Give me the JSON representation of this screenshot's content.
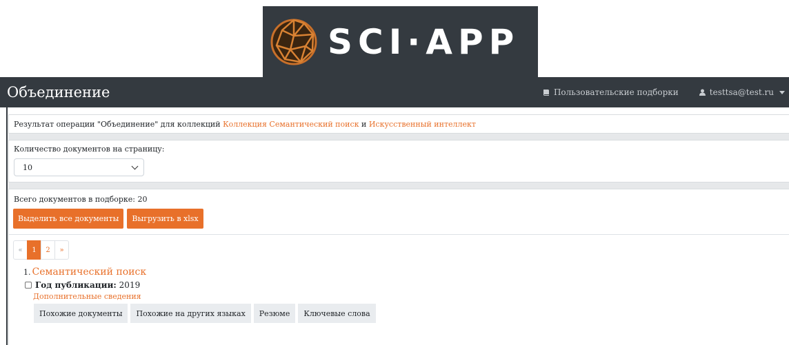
{
  "logo": {
    "text": "SCI·APP",
    "icon": "geodesic-sphere-icon",
    "background": "#343a40"
  },
  "navbar": {
    "brand": "Объединение",
    "collections_icon": "book-icon",
    "collections_label": "Пользовательские подборки",
    "user_icon": "user-icon",
    "user_label": "testtsa@test.ru"
  },
  "result": {
    "prefix": "Результат операции \"Объединение\" для коллекций ",
    "collection1": "Коллекция Семантический поиск",
    "and": " и ",
    "collection2": "Искусственный интеллект"
  },
  "per_page": {
    "label": "Количество документов на страницу:",
    "selected": "10"
  },
  "total_label": "Всего документов в подборке: 20",
  "buttons": {
    "select_all": "Выделить все документы",
    "export": "Выгрузить в xlsx"
  },
  "pagination": {
    "prev": "«",
    "pages": [
      "1",
      "2"
    ],
    "active": "1",
    "next": "»"
  },
  "documents": [
    {
      "number": "1.",
      "title": "Семантический поиск",
      "year_label": "Год публикации:",
      "year": "2019",
      "more": "Дополнительные сведения",
      "actions": [
        "Похожие документы",
        "Похожие на других языках",
        "Резюме",
        "Ключевые слова"
      ]
    }
  ],
  "colors": {
    "accent": "#e8702a",
    "navbar": "#343a40"
  }
}
